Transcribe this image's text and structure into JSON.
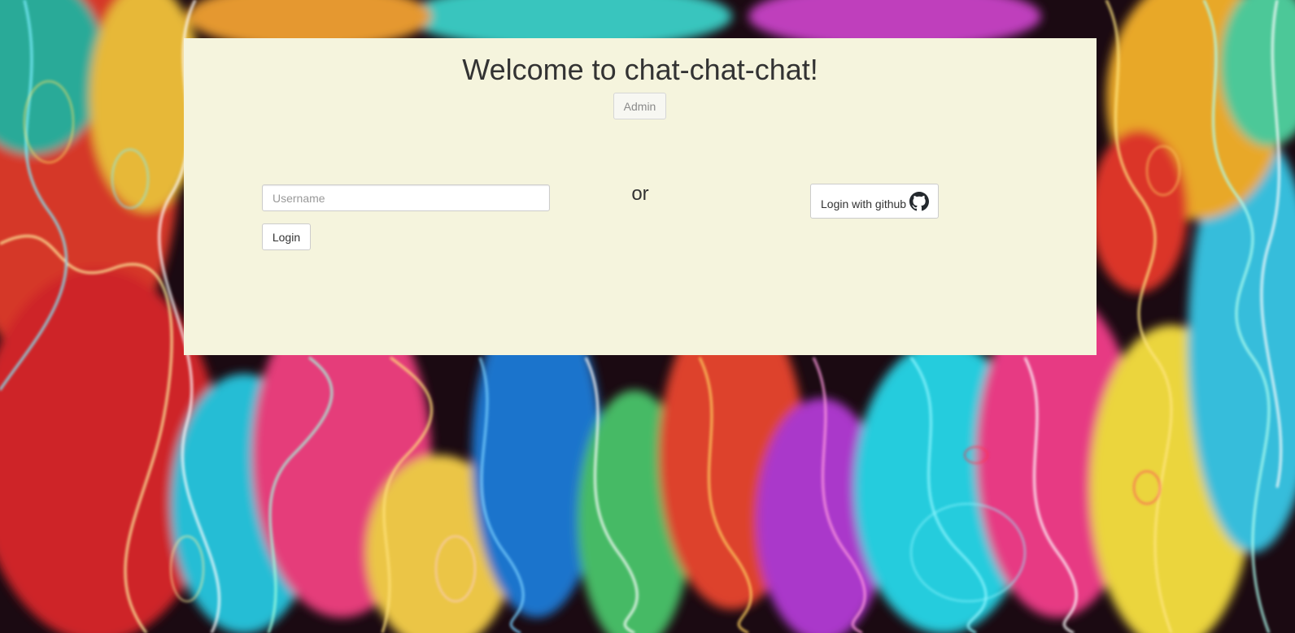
{
  "welcome": {
    "title": "Welcome to chat-chat-chat!",
    "admin_label": "Admin"
  },
  "login_form": {
    "username_placeholder": "Username",
    "username_value": "",
    "login_label": "Login"
  },
  "divider": {
    "text": "or"
  },
  "oauth": {
    "github_label": "Login with github",
    "github_icon": "github-icon"
  },
  "colors": {
    "panel_background": "#f5f4dd",
    "text": "#333333",
    "button_border": "#cccccc"
  }
}
